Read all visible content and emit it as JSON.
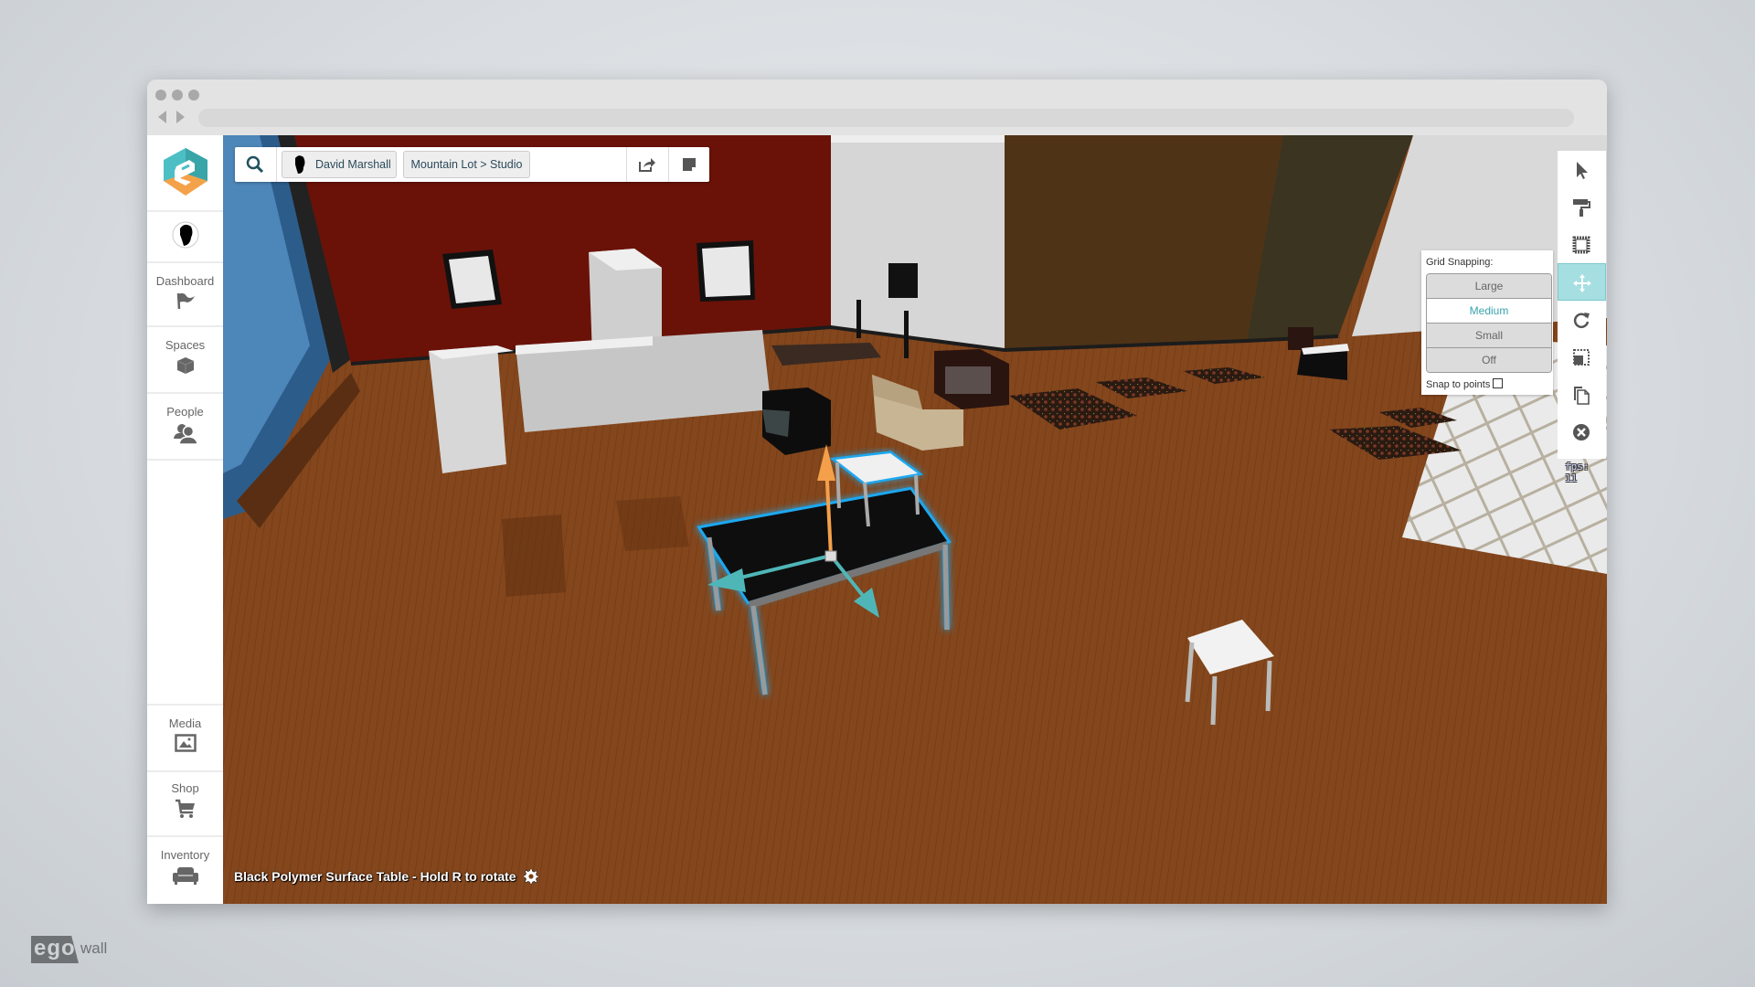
{
  "browser": {
    "traffic_lights": 3,
    "address": ""
  },
  "sidebar": {
    "logo": "ego-logo",
    "items": [
      {
        "label": "Dashboard",
        "icon": "flag-icon"
      },
      {
        "label": "Spaces",
        "icon": "cube-icon"
      },
      {
        "label": "People",
        "icon": "people-icon"
      },
      {
        "label": "Media",
        "icon": "image-icon"
      },
      {
        "label": "Shop",
        "icon": "cart-icon"
      },
      {
        "label": "Inventory",
        "icon": "sofa-icon"
      }
    ]
  },
  "topbar": {
    "search_icon": "search-icon",
    "user_name": "David Marshall",
    "location": "Mountain Lot > Studio",
    "share_icon": "share-icon",
    "note_icon": "note-icon"
  },
  "toolbar": {
    "tools": [
      {
        "name": "select",
        "icon": "cursor-icon",
        "active": false
      },
      {
        "name": "paint",
        "icon": "paint-roller-icon",
        "active": false
      },
      {
        "name": "frame",
        "icon": "frame-icon",
        "active": false
      },
      {
        "name": "move",
        "icon": "move-icon",
        "active": true
      },
      {
        "name": "rotate",
        "icon": "rotate-icon",
        "active": false
      },
      {
        "name": "scale",
        "icon": "scale-icon",
        "active": false
      },
      {
        "name": "duplicate",
        "icon": "copy-icon",
        "active": false
      },
      {
        "name": "delete",
        "icon": "delete-icon",
        "active": false
      }
    ],
    "accent": "#a6dfe2"
  },
  "grid_snapping": {
    "title": "Grid Snapping:",
    "options": [
      "Large",
      "Medium",
      "Small",
      "Off"
    ],
    "selected": "Medium",
    "snap_to_points_label": "Snap to points",
    "snap_to_points": false
  },
  "fps": "fps: 11",
  "status": {
    "text": "Black Polymer Surface Table - Hold R to rotate",
    "icon": "gear-icon"
  },
  "watermark": {
    "part1": "ego",
    "part2": "wall"
  },
  "colors": {
    "brand_teal": "#4cbfc5",
    "brand_orange": "#f4a24a",
    "selection_glow": "#1ea8f0",
    "gizmo_up": "#f4a04a",
    "gizmo_axis": "#4fb6b8"
  }
}
